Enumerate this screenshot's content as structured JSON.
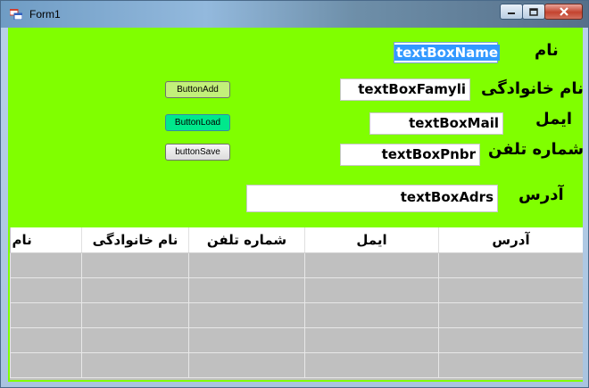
{
  "window": {
    "title": "Form1"
  },
  "labels": {
    "name": "نام",
    "family": "نام خانوادگی",
    "mail": "ایمل",
    "phone": "شماره تلفن",
    "address": "آدرس"
  },
  "textboxes": {
    "name": "textBoxName",
    "family": "textBoxFamyli",
    "mail": "textBoxMail",
    "phone": "textBoxPnbr",
    "address": "textBoxAdrs"
  },
  "buttons": {
    "add": "ButtonAdd",
    "load": "ButtonLoad",
    "save": "buttonSave"
  },
  "colors": {
    "form_background": "#80ff00",
    "button_add": "#c2f07a",
    "button_load": "#00e88c",
    "selection": "#3399ff"
  },
  "grid": {
    "columns": [
      "نام",
      "نام خانوادگی",
      "شماره تلفن",
      "ایمل",
      "آدرس"
    ],
    "rows": [
      [
        "",
        "",
        "",
        "",
        ""
      ],
      [
        "",
        "",
        "",
        "",
        ""
      ],
      [
        "",
        "",
        "",
        "",
        ""
      ],
      [
        "",
        "",
        "",
        "",
        ""
      ],
      [
        "",
        "",
        "",
        "",
        ""
      ]
    ]
  }
}
